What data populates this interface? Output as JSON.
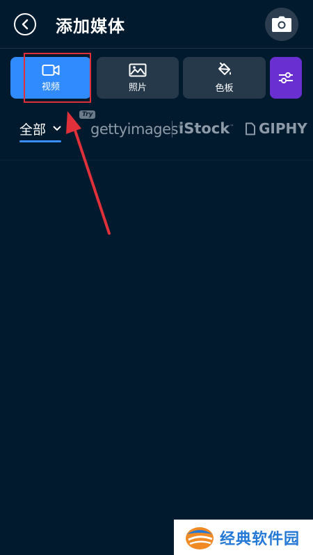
{
  "header": {
    "title": "添加媒体"
  },
  "tabs": [
    {
      "label": "视频",
      "active": true,
      "icon": "video-camera-icon"
    },
    {
      "label": "照片",
      "active": false,
      "icon": "image-icon"
    },
    {
      "label": "色板",
      "active": false,
      "icon": "paint-bucket-icon"
    },
    {
      "label": "",
      "active": false,
      "icon": "sliders-icon"
    }
  ],
  "sources": {
    "all_label": "全部",
    "try_badge": "Try",
    "getty": "gettyimages",
    "istock": "iStock",
    "giphy": "GIPHY"
  },
  "watermark": {
    "text": "经典软件园"
  },
  "colors": {
    "background": "#021a2e",
    "active_tab": "#2f8bff",
    "tab": "#26394b",
    "filter_tab": "#6a2fd1",
    "annotation": "#e0303a"
  }
}
